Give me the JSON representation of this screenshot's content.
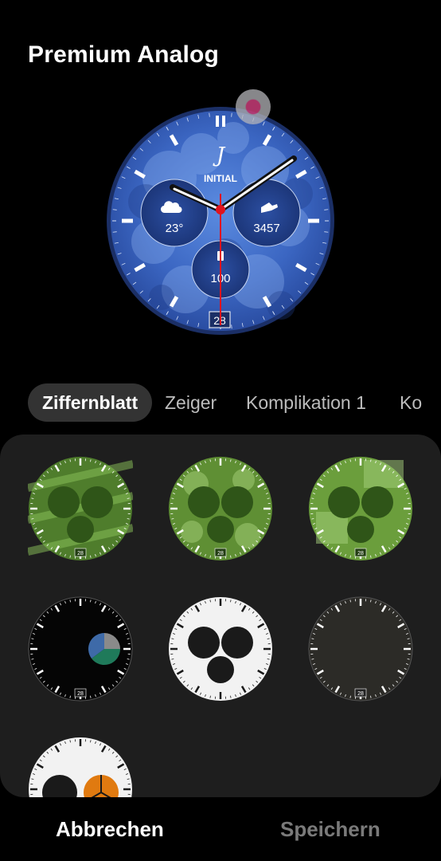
{
  "header": {
    "title": "Premium Analog"
  },
  "preview": {
    "logo_glyph": "J",
    "brand_text": "INITIAL",
    "weather_value": "23°",
    "steps_value": "3457",
    "battery_value": "100",
    "date_value": "28"
  },
  "tabs": [
    {
      "label": "Ziffernblatt",
      "active": true
    },
    {
      "label": "Zeiger",
      "active": false
    },
    {
      "label": "Komplikation 1",
      "active": false
    },
    {
      "label": "Ko",
      "active": false
    }
  ],
  "dials": [
    {
      "style": "green-stripes",
      "date": "28"
    },
    {
      "style": "green-camo",
      "date": "28"
    },
    {
      "style": "green-blocks",
      "date": "28"
    },
    {
      "style": "black-pie",
      "date": "28"
    },
    {
      "style": "white-three",
      "date": "28"
    },
    {
      "style": "dark-gray",
      "date": "28"
    },
    {
      "style": "white-orange",
      "date": ""
    }
  ],
  "footer": {
    "cancel_label": "Abbrechen",
    "save_label": "Speichern"
  },
  "colors": {
    "accent_blue": "#3a66c4",
    "hand_red": "#e0141e",
    "green_dial": "#6a9a3c",
    "tab_active_bg": "#333333"
  }
}
